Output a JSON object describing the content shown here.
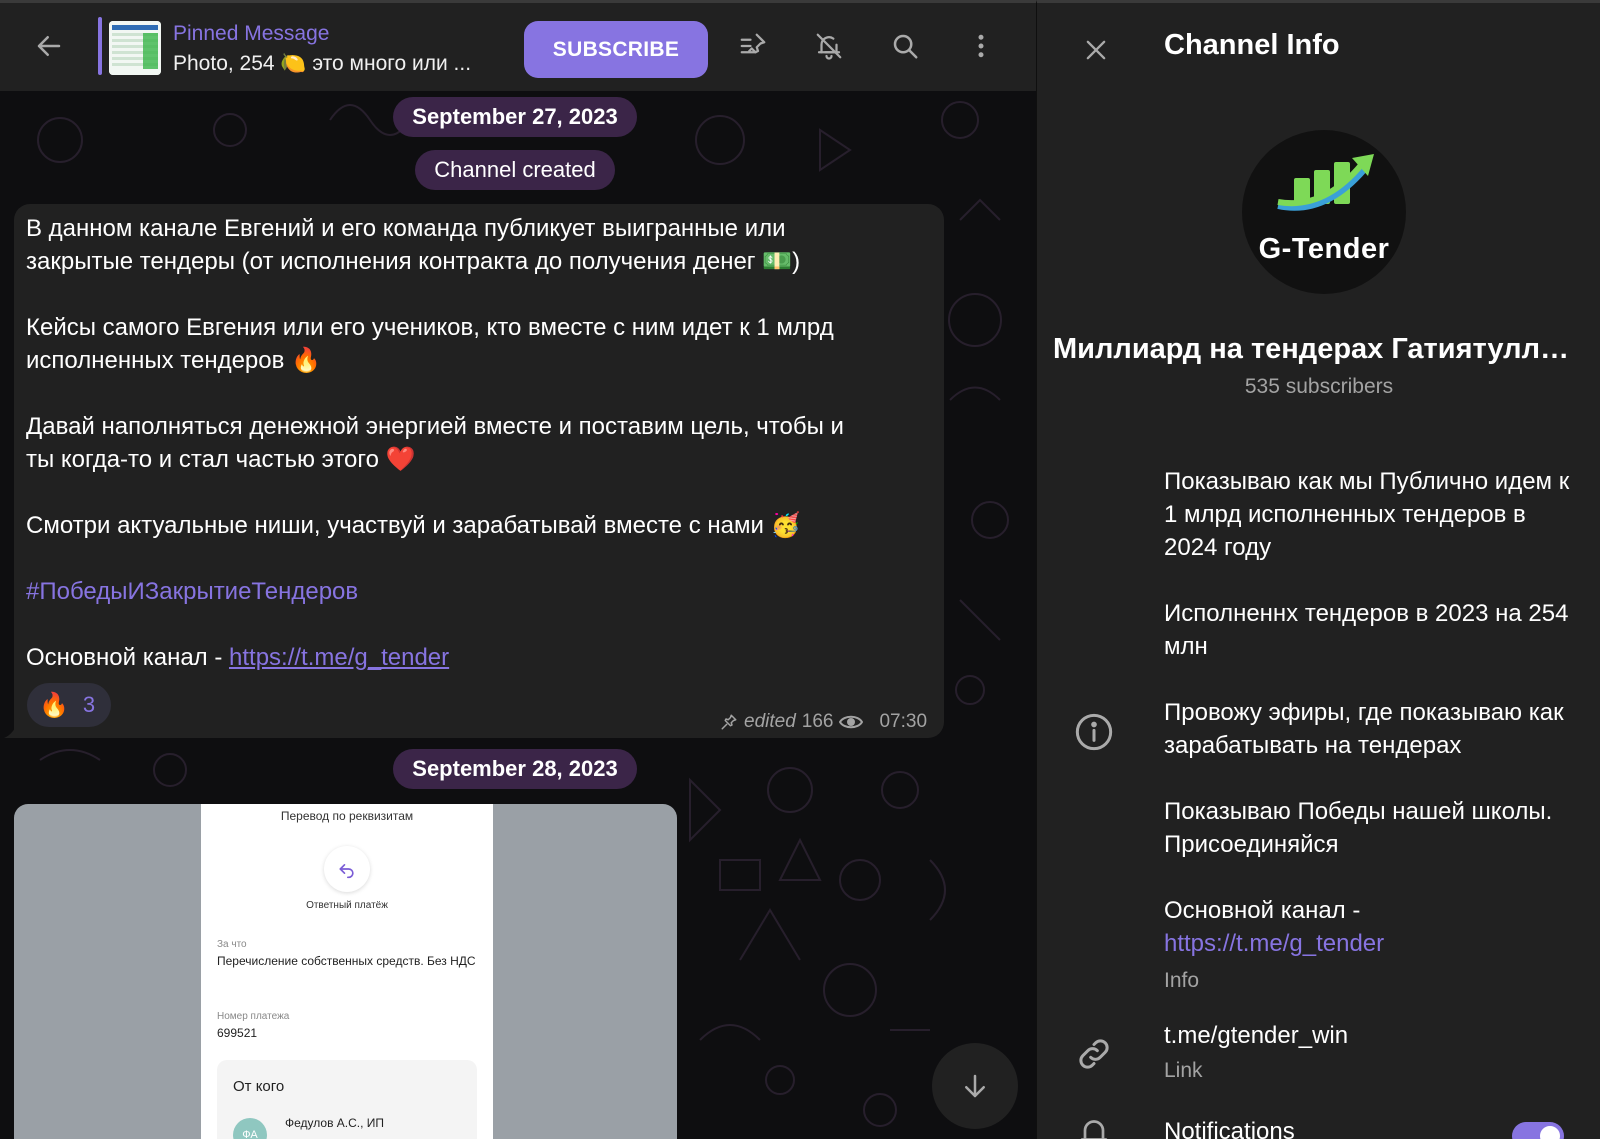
{
  "colors": {
    "accent": "#8774e1",
    "panel_bg": "#212121",
    "chat_bg": "#0e0e10",
    "date_pill_bg": "#3b2548",
    "secondary_text": "#a3a3a3"
  },
  "header": {
    "back_icon": "arrow-left-icon",
    "pinned": {
      "title": "Pinned Message",
      "text": "Photo, 254 🍋 это много или ..."
    },
    "subscribe_label": "SUBSCRIBE",
    "icons": [
      "pinned-messages-icon",
      "bell-off-icon",
      "search-icon",
      "more-vertical-icon"
    ]
  },
  "chat": {
    "date1": "September 27, 2023",
    "service_message": "Channel created",
    "message": {
      "p1": "В данном канале Евгений и его команда публикует выигранные или",
      "p1b": "закрытые тендеры (от исполнения контракта до получения денег 💵)",
      "p2": "Кейсы самого Евгения или его учеников, кто вместе с ним идет к 1 млрд",
      "p2b": "исполненных тендеров 🔥",
      "p3": "Давай наполняться денежной энергией вместе и поставим цель, чтобы и",
      "p3b": "ты когда-то и стал частью этого ❤️",
      "p4": "Смотри актуальные ниши, участвуй и зарабатывай вместе с нами 🥳",
      "hashtag": "#ПобедыИЗакрытиеТендеров",
      "main_channel_prefix": "Основной канал - ",
      "main_channel_link": "https://t.me/g_tender",
      "reaction_emoji": "🔥",
      "reaction_count": "3",
      "meta_edited": "edited",
      "meta_views": "166",
      "meta_time": "07:30"
    },
    "date2": "September 28, 2023",
    "photo": {
      "title": "Перевод по реквизитам",
      "reply_label": "Ответный платёж",
      "for_label": "За что",
      "for_value": "Перечисление собственных средств. Без НДС",
      "number_label": "Номер платежа",
      "number_value": "699521",
      "from_label": "От кого",
      "from_avatar": "ФА",
      "from_name": "Федулов А.С., ИП"
    },
    "scroll_down_icon": "arrow-down-icon"
  },
  "panel": {
    "close_icon": "close-icon",
    "title": "Channel Info",
    "avatar_text": "G-Tender",
    "channel_name": "Миллиард на тендерах Гатиятуллина",
    "subscribers": "535 subscribers",
    "about": {
      "p1": "Показываю как мы Публично идем к 1 млрд исполненных тендеров в 2024 году",
      "p2": "Исполненнх тендеров в 2023 на 254 млн",
      "p3": "Провожу эфиры, где показываю как зарабатывать на тендерах",
      "p4": "Показываю Победы нашей школы. Присоединяйся",
      "p5_prefix": "Основной канал -",
      "p5_link": "https://t.me/g_tender",
      "sub": "Info"
    },
    "link": {
      "value": "t.me/gtender_win",
      "sub": "Link"
    },
    "notifications": {
      "label": "Notifications",
      "enabled": true
    }
  }
}
